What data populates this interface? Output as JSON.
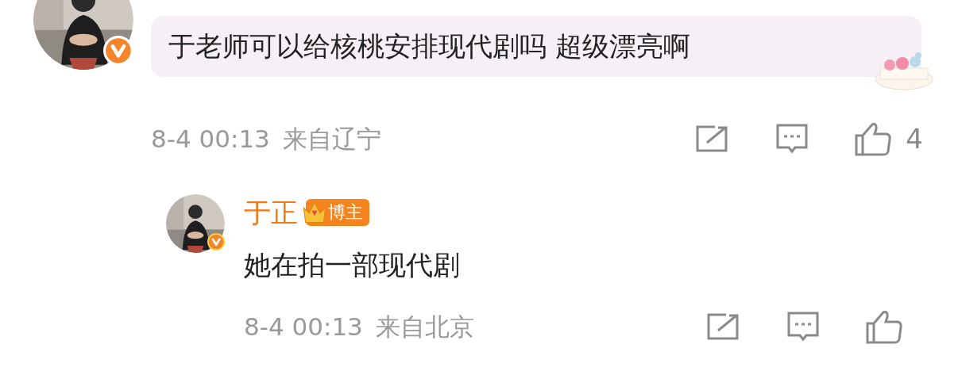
{
  "comment": {
    "text": "于老师可以给核桃安排现代剧吗 超级漂亮啊",
    "time": "8-4 00:13",
    "location": "来自辽宁",
    "likes": "4"
  },
  "reply": {
    "author": "于正",
    "badge": "博主",
    "text": "她在拍一部现代剧",
    "time": "8-4 00:13",
    "location": "来自北京"
  }
}
